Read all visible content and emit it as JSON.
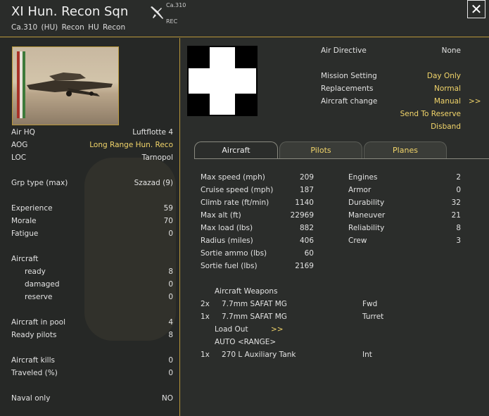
{
  "header": {
    "title": "XI Hun. Recon Sqn",
    "subtitle": "Ca.310 (HU)   Recon   HU Recon",
    "plane_type": "Ca.310",
    "plane_role": "REC",
    "close_label": "✕",
    "plane_icon": "aircraft-icon"
  },
  "left": {
    "rows": [
      {
        "label": "Air HQ",
        "value": "Luftflotte 4"
      },
      {
        "label": "AOG",
        "value": "Long Range Hun. Reco"
      },
      {
        "label": "LOC",
        "value": "Tarnopol"
      },
      {
        "label": "Grp type (max)",
        "value": "Szazad (9)"
      },
      {
        "label": "Experience",
        "value": "59"
      },
      {
        "label": "Morale",
        "value": "70"
      },
      {
        "label": "Fatigue",
        "value": "0"
      },
      {
        "label": "Aircraft",
        "value": ""
      },
      {
        "label": "ready",
        "value": "8"
      },
      {
        "label": "damaged",
        "value": "0"
      },
      {
        "label": "reserve",
        "value": "0"
      },
      {
        "label": "Aircraft in pool",
        "value": "4"
      },
      {
        "label": "Ready pilots",
        "value": "8"
      },
      {
        "label": "Aircraft kills",
        "value": "0"
      },
      {
        "label": "Traveled (%)",
        "value": "0"
      },
      {
        "label": "Naval only",
        "value": "NO"
      }
    ]
  },
  "right": {
    "settings": [
      {
        "label": "Air Directive",
        "value": "None"
      },
      {
        "label": "Mission Setting",
        "value": "Day Only"
      },
      {
        "label": "Replacements",
        "value": "Normal"
      },
      {
        "label": "Aircraft change",
        "value": "Manual"
      }
    ],
    "aircraft_change_arrow": ">>",
    "send_to_reserve": "Send To Reserve",
    "disband": "Disband",
    "tabs": [
      "Aircraft",
      "Pilots",
      "Planes"
    ],
    "stats_left": [
      {
        "label": "Max speed (mph)",
        "value": "209"
      },
      {
        "label": "Cruise speed (mph)",
        "value": "187"
      },
      {
        "label": "Climb rate (ft/min)",
        "value": "1140"
      },
      {
        "label": "Max alt (ft)",
        "value": "22969"
      },
      {
        "label": "Max load (lbs)",
        "value": "882"
      },
      {
        "label": "Radius (miles)",
        "value": "406"
      },
      {
        "label": "Sortie ammo (lbs)",
        "value": "60"
      },
      {
        "label": "Sortie fuel (lbs)",
        "value": "2169"
      }
    ],
    "stats_right": [
      {
        "label": "Engines",
        "value": "2"
      },
      {
        "label": "Armor",
        "value": "0"
      },
      {
        "label": "Durability",
        "value": "32"
      },
      {
        "label": "Maneuver",
        "value": "21"
      },
      {
        "label": "Reliability",
        "value": "8"
      },
      {
        "label": "Crew",
        "value": "3"
      }
    ],
    "weapons_title": "Aircraft Weapons",
    "weapons": [
      {
        "qty": "2x",
        "name": "7.7mm SAFAT MG",
        "pos": "Fwd"
      },
      {
        "qty": "1x",
        "name": "7.7mm SAFAT MG",
        "pos": "Turret"
      }
    ],
    "loadout_label": "Load Out",
    "loadout_arrow": ">>",
    "loadout_mode": "AUTO <RANGE>",
    "extra": [
      {
        "qty": "1x",
        "name": "270 L Auxiliary Tank",
        "pos": "Int"
      }
    ]
  }
}
